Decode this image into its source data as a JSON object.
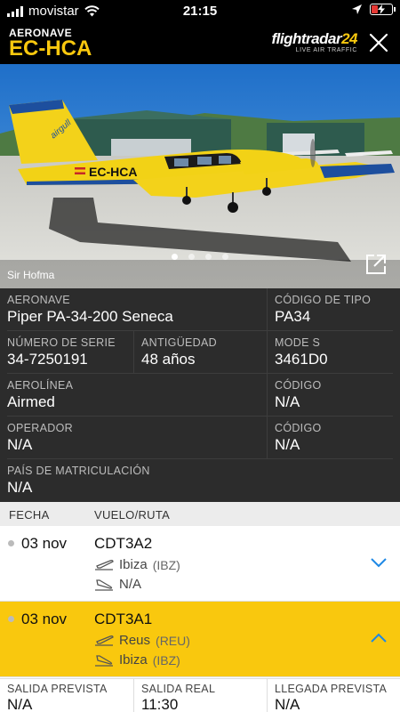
{
  "status_bar": {
    "carrier": "movistar",
    "time": "21:15"
  },
  "header": {
    "label": "AERONAVE",
    "registration": "EC-HCA",
    "brand_name": "flightradar",
    "brand_num": "24",
    "brand_sub": "LIVE AIR TRAFFIC"
  },
  "photo": {
    "credit": "Sir Hofma",
    "livery_reg": "EC-HCA",
    "livery_brand": "airgull",
    "dots": 4,
    "active_dot": 0
  },
  "details": {
    "aircraft_label": "AERONAVE",
    "aircraft_value": "Piper PA-34-200 Seneca",
    "type_code_label": "CÓDIGO DE TIPO",
    "type_code_value": "PA34",
    "serial_label": "NÚMERO DE SERIE",
    "serial_value": "34-7250191",
    "age_label": "ANTIGÜEDAD",
    "age_value": "48 años",
    "modes_label": "MODE S",
    "modes_value": "3461D0",
    "airline_label": "AEROLÍNEA",
    "airline_value": "Airmed",
    "airline_code_label": "CÓDIGO",
    "airline_code_value": "N/A",
    "operator_label": "OPERADOR",
    "operator_value": "N/A",
    "operator_code_label": "CÓDIGO",
    "operator_code_value": "N/A",
    "country_label": "PAÍS DE MATRICULACIÓN",
    "country_value": "N/A"
  },
  "flights": {
    "col_date": "FECHA",
    "col_route": "VUELO/RUTA",
    "rows": [
      {
        "date": "03 nov",
        "flight": "CDT3A2",
        "from": "Ibiza",
        "from_code": "(IBZ)",
        "to": "N/A",
        "to_code": ""
      },
      {
        "date": "03 nov",
        "flight": "CDT3A1",
        "from": "Reus",
        "from_code": "(REU)",
        "to": "Ibiza",
        "to_code": "(IBZ)"
      }
    ]
  },
  "times": {
    "sched_dep_label": "SALIDA PREVISTA",
    "sched_dep_value": "N/A",
    "actual_dep_label": "SALIDA REAL",
    "actual_dep_value": "11:30",
    "sched_arr_label": "LLEGADA PREVISTA",
    "sched_arr_value": "N/A"
  },
  "colors": {
    "accent": "#f9c80e",
    "panel": "#2c2c2c",
    "link": "#1e88e5"
  }
}
